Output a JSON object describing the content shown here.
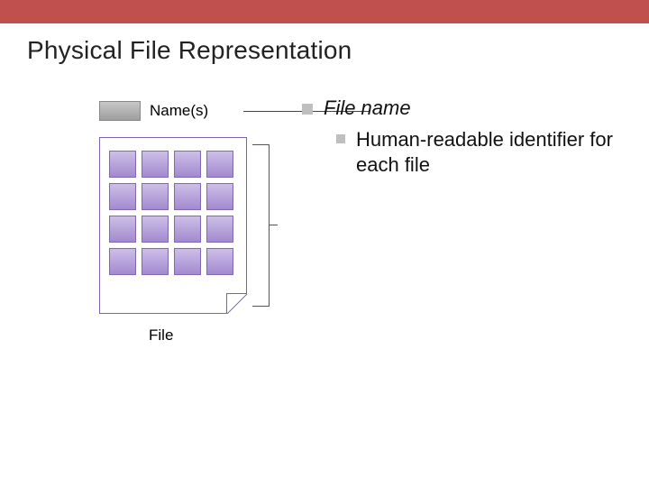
{
  "topbar": {
    "color": "#c0504d"
  },
  "title": "Physical File Representation",
  "diagram": {
    "names_label": "Name(s)",
    "file_caption": "File",
    "grid": {
      "rows": 4,
      "cols": 4
    }
  },
  "bullets": {
    "level1": "File name",
    "level2": "Human-readable identifier for each file"
  }
}
